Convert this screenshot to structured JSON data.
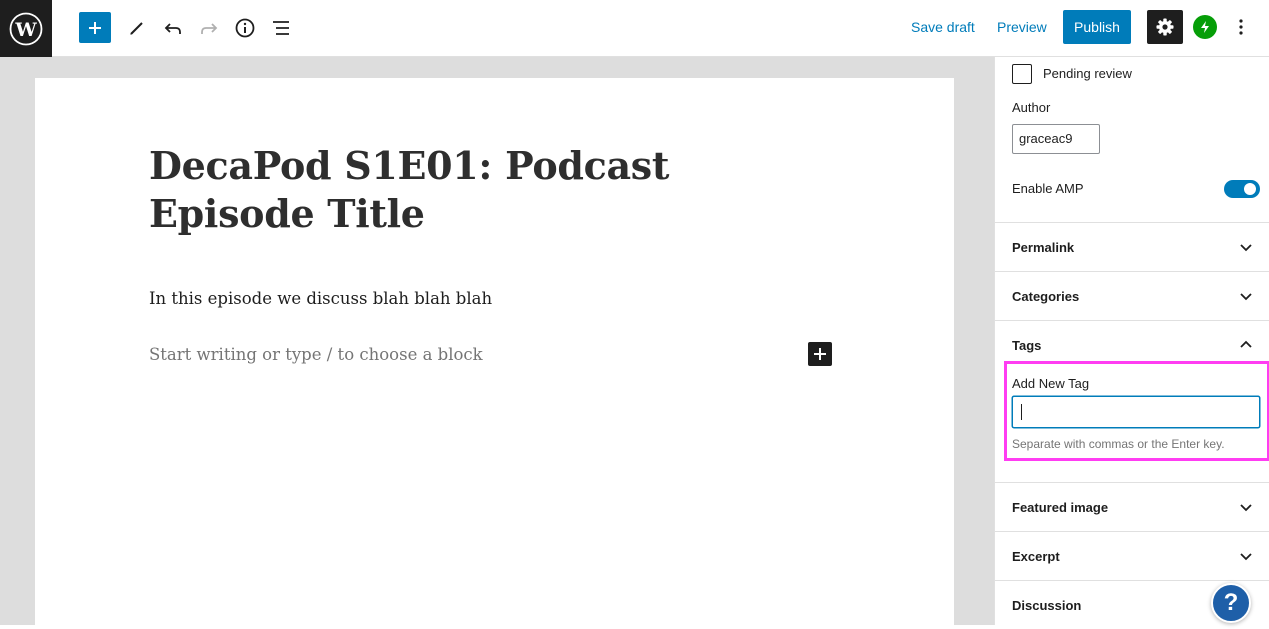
{
  "toolbar": {
    "save_draft": "Save draft",
    "preview": "Preview",
    "publish": "Publish",
    "accent_color": "#007cba"
  },
  "icons": {
    "logo": "wordpress-logo-icon",
    "add": "plus-icon",
    "tools": "pencil-icon",
    "undo": "undo-icon",
    "redo": "redo-icon",
    "details": "info-icon",
    "outline": "list-view-icon",
    "settings": "gear-icon",
    "jetpack": "jetpack-bolt-icon",
    "more": "vertical-ellipsis-icon",
    "help": "question-mark-icon"
  },
  "editor": {
    "title": "DecaPod S1E01: Podcast Episode Title",
    "paragraph": "In this episode we discuss blah blah blah",
    "placeholder": "Start writing or type / to choose a block"
  },
  "sidebar": {
    "pending_review": "Pending review",
    "author_label": "Author",
    "author_value": "graceac9",
    "amp_label": "Enable AMP",
    "amp_enabled": true,
    "panels": {
      "permalink": "Permalink",
      "categories": "Categories",
      "tags": "Tags",
      "featured_image": "Featured image",
      "excerpt": "Excerpt",
      "discussion": "Discussion"
    },
    "tags": {
      "add_label": "Add New Tag",
      "value": "",
      "help": "Separate with commas or the Enter key."
    },
    "highlight_color": "#ff3df2"
  },
  "help_button": "?"
}
